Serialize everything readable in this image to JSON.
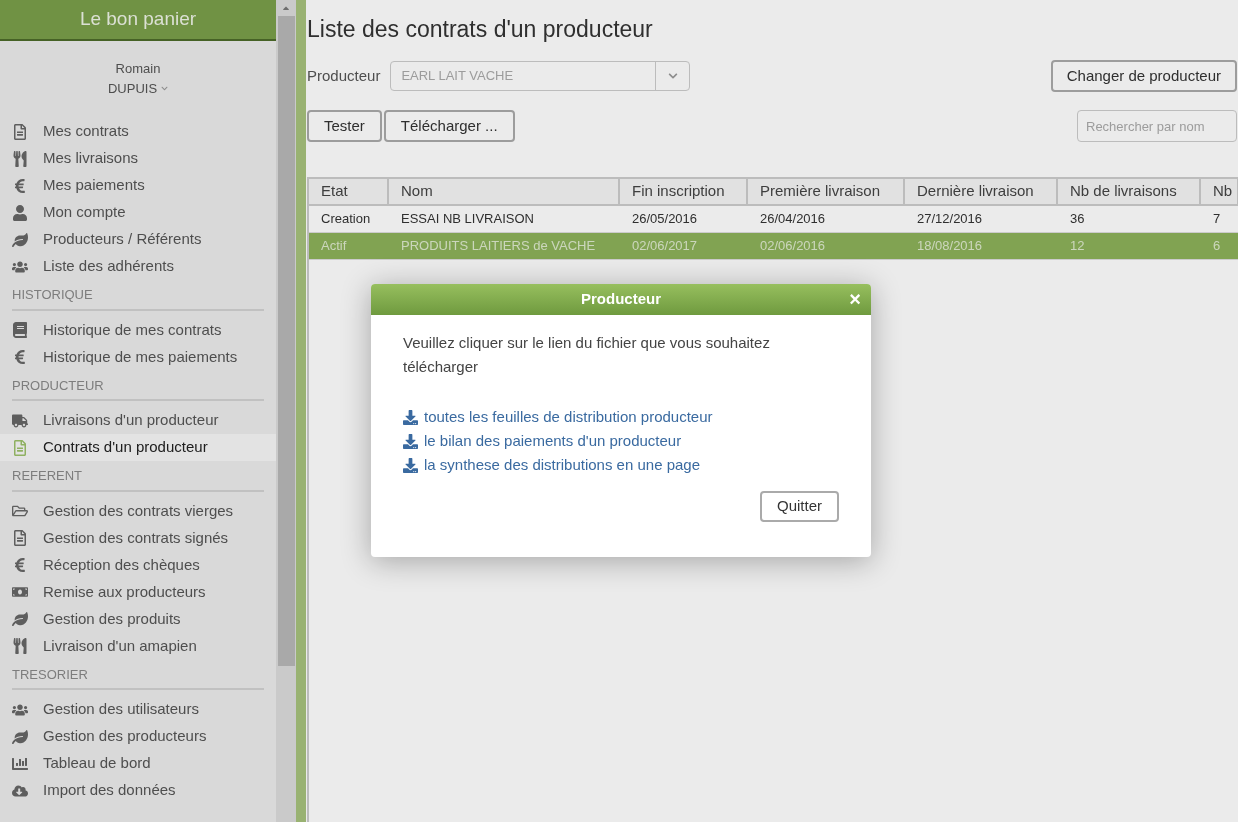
{
  "app_title": "Le bon panier",
  "user": {
    "first_name": "Romain",
    "last_name": "DUPUIS"
  },
  "sidebar": {
    "items": [
      {
        "label": "Mes contrats",
        "selected": false
      },
      {
        "label": "Mes livraisons",
        "selected": false
      },
      {
        "label": "Mes paiements",
        "selected": false
      },
      {
        "label": "Mon compte",
        "selected": false
      },
      {
        "label": "Producteurs / Référents",
        "selected": false
      },
      {
        "label": "Liste des adhérents",
        "selected": false
      }
    ],
    "sections": [
      {
        "title": "HISTORIQUE",
        "items": [
          {
            "label": "Historique de mes contrats",
            "selected": false
          },
          {
            "label": "Historique de mes paiements",
            "selected": false
          }
        ]
      },
      {
        "title": "PRODUCTEUR",
        "items": [
          {
            "label": "Livraisons d'un producteur",
            "selected": false
          },
          {
            "label": "Contrats d'un producteur",
            "selected": true
          }
        ]
      },
      {
        "title": "REFERENT",
        "items": [
          {
            "label": "Gestion des contrats vierges",
            "selected": false
          },
          {
            "label": "Gestion des contrats signés",
            "selected": false
          },
          {
            "label": "Réception des chèques",
            "selected": false
          },
          {
            "label": "Remise aux producteurs",
            "selected": false
          },
          {
            "label": "Gestion des produits",
            "selected": false
          },
          {
            "label": "Livraison d'un amapien",
            "selected": false
          }
        ]
      },
      {
        "title": "TRESORIER",
        "items": [
          {
            "label": "Gestion des utilisateurs",
            "selected": false
          },
          {
            "label": "Gestion des producteurs",
            "selected": false
          },
          {
            "label": "Tableau de bord",
            "selected": false
          },
          {
            "label": "Import des données",
            "selected": false
          }
        ]
      }
    ]
  },
  "page_title": "Liste des contrats d'un producteur",
  "producer_label": "Producteur",
  "producer_value": "EARL LAIT VACHE",
  "change_button": "Changer de producteur",
  "buttons": [
    "Tester",
    "Télécharger ..."
  ],
  "search": {
    "placeholder": "Rechercher par nom"
  },
  "table": {
    "columns": [
      "Etat",
      "Nom",
      "Fin inscription",
      "Première livraison",
      "Dernière livraison",
      "Nb de livraisons",
      "Nb"
    ],
    "rows": [
      {
        "cells": [
          "Creation",
          "ESSAI NB LIVRAISON",
          "26/05/2016",
          "26/04/2016",
          "27/12/2016",
          "36",
          "7"
        ],
        "selected": false
      },
      {
        "cells": [
          "Actif",
          "PRODUITS LAITIERS de VACHE",
          "02/06/2017",
          "02/06/2016",
          "18/08/2016",
          "12",
          "6"
        ],
        "selected": true
      }
    ]
  },
  "dialog": {
    "title": "Producteur",
    "close": "×",
    "message": "Veuillez cliquer sur le lien du fichier que vous souhaitez télécharger",
    "links": [
      "toutes les feuilles de distribution producteur",
      "le bilan des paiements d'un producteur",
      "la synthese des distributions en une page"
    ],
    "button": "Quitter"
  }
}
